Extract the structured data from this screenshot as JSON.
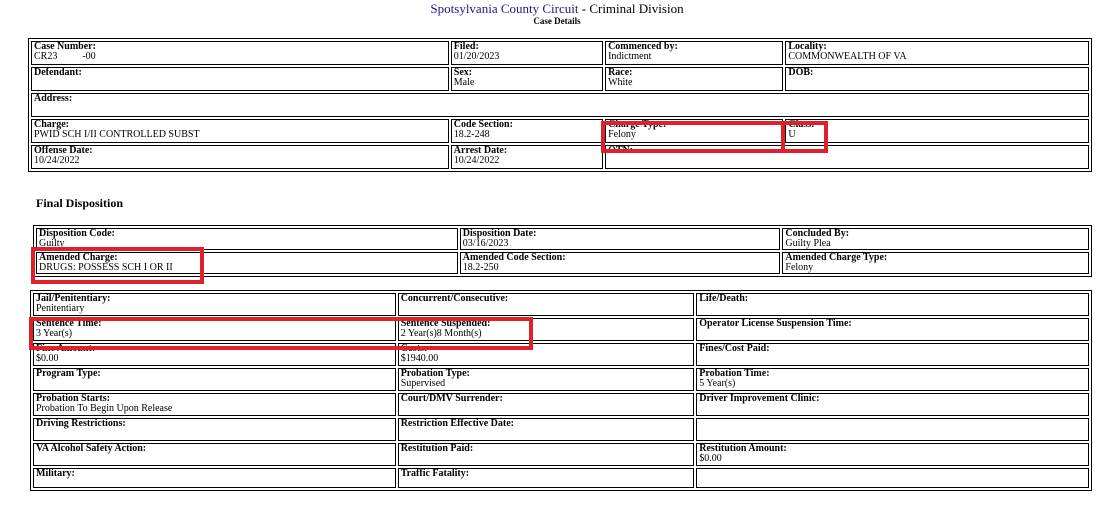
{
  "header": {
    "court": "Spotsylvania County Circuit",
    "division": " - Criminal Division",
    "subtitle": "Case Details"
  },
  "case_details": {
    "case_number": {
      "label": "Case Number:",
      "value": "CR23          -00"
    },
    "filed": {
      "label": "Filed:",
      "value": "01/20/2023"
    },
    "commenced_by": {
      "label": "Commenced by:",
      "value": "Indictment"
    },
    "locality": {
      "label": "Locality:",
      "value": "COMMONWEALTH OF VA"
    },
    "defendant": {
      "label": "Defendant:",
      "value": ""
    },
    "sex": {
      "label": "Sex:",
      "value": "Male"
    },
    "race": {
      "label": "Race:",
      "value": "White"
    },
    "dob": {
      "label": "DOB:",
      "value": ""
    },
    "address": {
      "label": "Address:",
      "value": ""
    },
    "charge": {
      "label": "Charge:",
      "value": "PWID SCH I/II CONTROLLED SUBST"
    },
    "code_section": {
      "label": "Code Section:",
      "value": "18.2-248"
    },
    "charge_type": {
      "label": "Charge Type:",
      "value": "Felony"
    },
    "class": {
      "label": "Class:",
      "value": "U"
    },
    "offense_date": {
      "label": "Offense Date:",
      "value": "10/24/2022"
    },
    "arrest_date": {
      "label": "Arrest Date:",
      "value": "10/24/2022"
    },
    "otn": {
      "label": "OTN:",
      "value": ""
    }
  },
  "final_disposition": {
    "title": "Final Disposition",
    "disposition_code": {
      "label": "Disposition Code:",
      "value": "Guilty"
    },
    "disposition_date": {
      "label": "Disposition Date:",
      "value": "03/16/2023"
    },
    "concluded_by": {
      "label": "Concluded By:",
      "value": "Guilty Plea"
    },
    "amended_charge": {
      "label": "Amended Charge:",
      "value": "DRUGS: POSSESS SCH I OR II"
    },
    "amended_code_section": {
      "label": "Amended Code Section:",
      "value": "18.2-250"
    },
    "amended_charge_type": {
      "label": "Amended Charge Type:",
      "value": "Felony"
    }
  },
  "sentencing": {
    "jail": {
      "label": "Jail/Penitentiary:",
      "value": "Penitentiary"
    },
    "concurrent": {
      "label": "Concurrent/Consecutive:",
      "value": ""
    },
    "life_death": {
      "label": "Life/Death:",
      "value": ""
    },
    "sentence_time": {
      "label": "Sentence Time:",
      "value": "3 Year(s)"
    },
    "sentence_suspended": {
      "label": "Sentence Suspended:",
      "value": "2 Year(s)8 Month(s)"
    },
    "license_suspension": {
      "label": "Operator License Suspension Time:",
      "value": ""
    },
    "fine_amount": {
      "label": "Fine Amount:",
      "value": "$0.00"
    },
    "costs": {
      "label": "Costs:",
      "value": "$1940.00"
    },
    "fines_paid": {
      "label": "Fines/Cost Paid:",
      "value": ""
    },
    "program_type": {
      "label": "Program Type:",
      "value": ""
    },
    "probation_type": {
      "label": "Probation Type:",
      "value": "Supervised"
    },
    "probation_time": {
      "label": "Probation Time:",
      "value": "5 Year(s)"
    },
    "probation_starts": {
      "label": "Probation Starts:",
      "value": "Probation To Begin Upon Release"
    },
    "court_dmv": {
      "label": "Court/DMV Surrender:",
      "value": ""
    },
    "driver_clinic": {
      "label": "Driver Improvement Clinic:",
      "value": ""
    },
    "driving_restrictions": {
      "label": "Driving Restrictions:",
      "value": ""
    },
    "restriction_date": {
      "label": "Restriction Effective Date:",
      "value": ""
    },
    "blank": {
      "label": "",
      "value": ""
    },
    "vasap": {
      "label": "VA Alcohol Safety Action:",
      "value": ""
    },
    "restitution_paid": {
      "label": "Restitution Paid:",
      "value": ""
    },
    "restitution_amount": {
      "label": "Restitution Amount:",
      "value": "$0.00"
    },
    "military": {
      "label": "Military:",
      "value": ""
    },
    "traffic_fatality": {
      "label": "Traffic Fatality:",
      "value": ""
    }
  },
  "colors": {
    "highlight": "#e0202a",
    "court_link": "#1a1a8c"
  }
}
